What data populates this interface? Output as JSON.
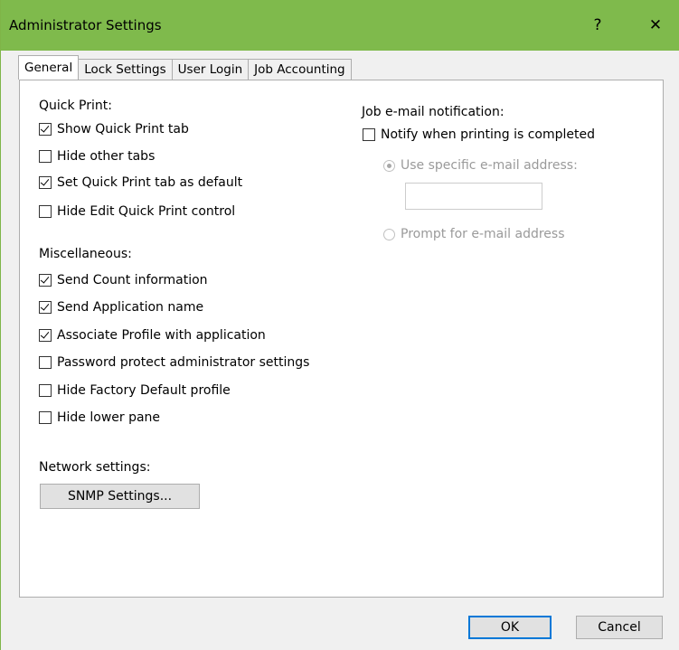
{
  "window": {
    "title": "Administrator Settings",
    "help_label": "?",
    "close_label": "✕",
    "accent_color": "#7fba4c"
  },
  "tabs": [
    {
      "label": "General",
      "active": true
    },
    {
      "label": "Lock Settings",
      "active": false
    },
    {
      "label": "User Login",
      "active": false
    },
    {
      "label": "Job Accounting",
      "active": false
    }
  ],
  "quick_print": {
    "label": "Quick Print:",
    "items": [
      {
        "label": "Show Quick Print tab",
        "checked": true
      },
      {
        "label": "Hide other tabs",
        "checked": false
      },
      {
        "label": "Set Quick Print tab as default",
        "checked": true
      },
      {
        "label": "Hide Edit Quick Print control",
        "checked": false
      }
    ]
  },
  "miscellaneous": {
    "label": "Miscellaneous:",
    "items": [
      {
        "label": "Send Count information",
        "checked": true
      },
      {
        "label": "Send Application name",
        "checked": true
      },
      {
        "label": "Associate Profile with application",
        "checked": true
      },
      {
        "label": "Password protect administrator settings",
        "checked": false
      },
      {
        "label": "Hide Factory Default profile",
        "checked": false
      },
      {
        "label": "Hide lower pane",
        "checked": false
      }
    ]
  },
  "network": {
    "label": "Network settings:",
    "snmp_button": "SNMP Settings..."
  },
  "job_email": {
    "label": "Job e-mail notification:",
    "notify_label": "Notify when printing is completed",
    "notify_checked": false,
    "use_specific_label": "Use specific e-mail address:",
    "use_specific_selected": true,
    "email_value": "",
    "prompt_label": "Prompt for e-mail address",
    "prompt_selected": false
  },
  "footer": {
    "ok_label": "OK",
    "cancel_label": "Cancel"
  }
}
